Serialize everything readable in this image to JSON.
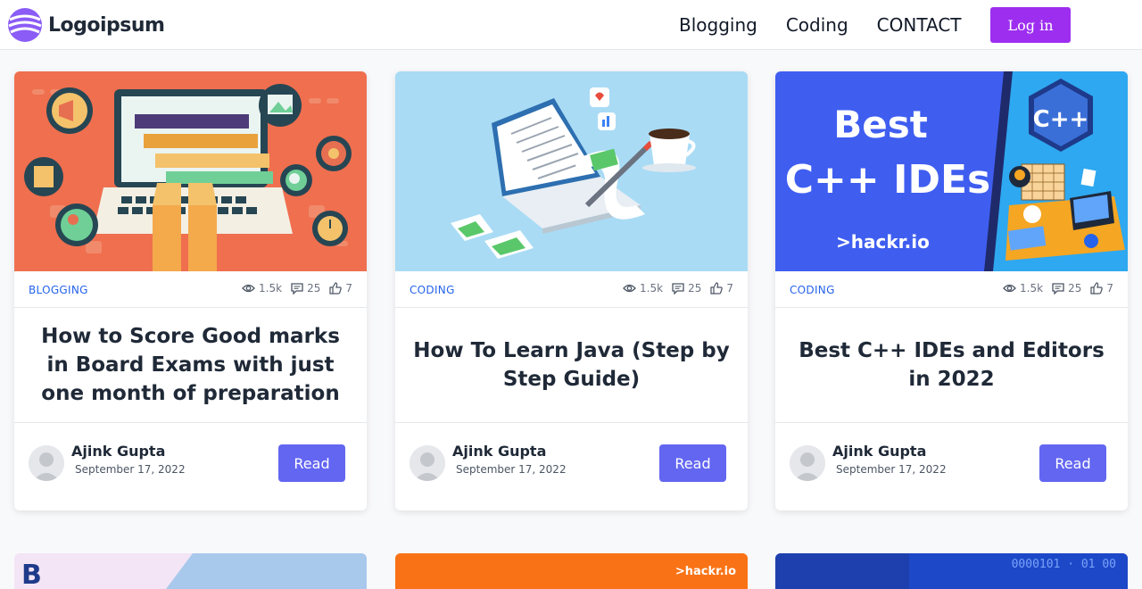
{
  "header": {
    "logo_text": "Logoipsum",
    "nav": [
      "Blogging",
      "Coding",
      "CONTACT"
    ],
    "login_label": "Log in",
    "accent_color": "#9d2ef0"
  },
  "cards": [
    {
      "image_icon": "exam-laptop-illustration",
      "image_text": "",
      "category": "BLOGGING",
      "views": "1.5k",
      "comments": "25",
      "likes": "7",
      "title": "How to Score Good marks in Board Exams with just one month of preparation",
      "author": "Ajink Gupta",
      "date": "September 17, 2022",
      "read_label": "Read"
    },
    {
      "image_icon": "java-laptop-illustration",
      "image_text": "",
      "category": "CODING",
      "views": "1.5k",
      "comments": "25",
      "likes": "7",
      "title": "How To Learn Java (Step by Step Guide)",
      "author": "Ajink Gupta",
      "date": "September 17, 2022",
      "read_label": "Read"
    },
    {
      "image_icon": "cpp-ide-illustration",
      "image_text": {
        "line1": "Best",
        "line2": "C++ IDEs",
        "brand": ">hackr.io",
        "logo": "C++"
      },
      "category": "CODING",
      "views": "1.5k",
      "comments": "25",
      "likes": "7",
      "title": "Best C++ IDEs and Editors in 2022",
      "author": "Ajink Gupta",
      "date": "September 17, 2022",
      "read_label": "Read"
    }
  ],
  "partial_cards": [
    {
      "text": "B",
      "color": "#f3e5f5"
    },
    {
      "text": ">hackr.io",
      "color": "#f97316"
    },
    {
      "text": "0000101 · 01 00",
      "color": "#1e40af"
    }
  ]
}
